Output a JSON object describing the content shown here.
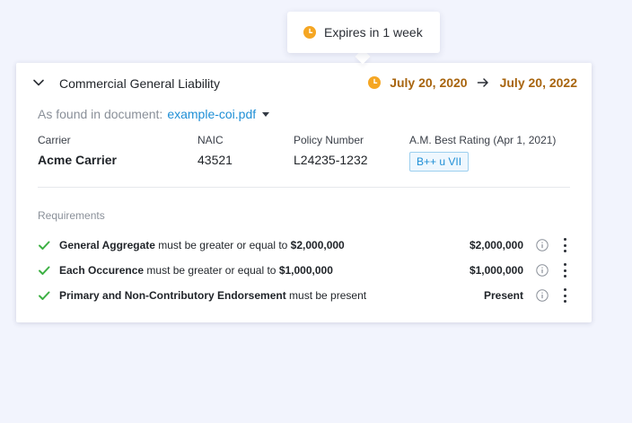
{
  "colors": {
    "background": "#f2f4fd",
    "accent_date": "#a8650f",
    "clock": "#f5a623",
    "link": "#1f8fd6",
    "check": "#3cb043"
  },
  "tooltip": {
    "icon": "clock-icon",
    "text": "Expires in 1 week"
  },
  "card": {
    "title": "Commercial General Liability",
    "start_date": "July 20, 2020",
    "end_date": "July 20, 2022",
    "found_label": "As found in document:",
    "found_file": "example-coi.pdf",
    "info": {
      "carrier_label": "Carrier",
      "carrier_value": "Acme Carrier",
      "naic_label": "NAIC",
      "naic_value": "43521",
      "policy_label": "Policy Number",
      "policy_value": "L24235-1232",
      "rating_label": "A.M. Best Rating (Apr 1, 2021)",
      "rating_value": "B++ u VII"
    },
    "requirements_heading": "Requirements",
    "requirements": [
      {
        "name": "General Aggregate",
        "condition": " must be greater or equal to ",
        "threshold": "$2,000,000",
        "value": "$2,000,000"
      },
      {
        "name": "Each Occurence",
        "condition": " must be greater or equal to ",
        "threshold": "$1,000,000",
        "value": "$1,000,000"
      },
      {
        "name": "Primary and Non-Contributory Endorsement",
        "condition": " must be present",
        "threshold": "",
        "value": "Present"
      }
    ]
  }
}
